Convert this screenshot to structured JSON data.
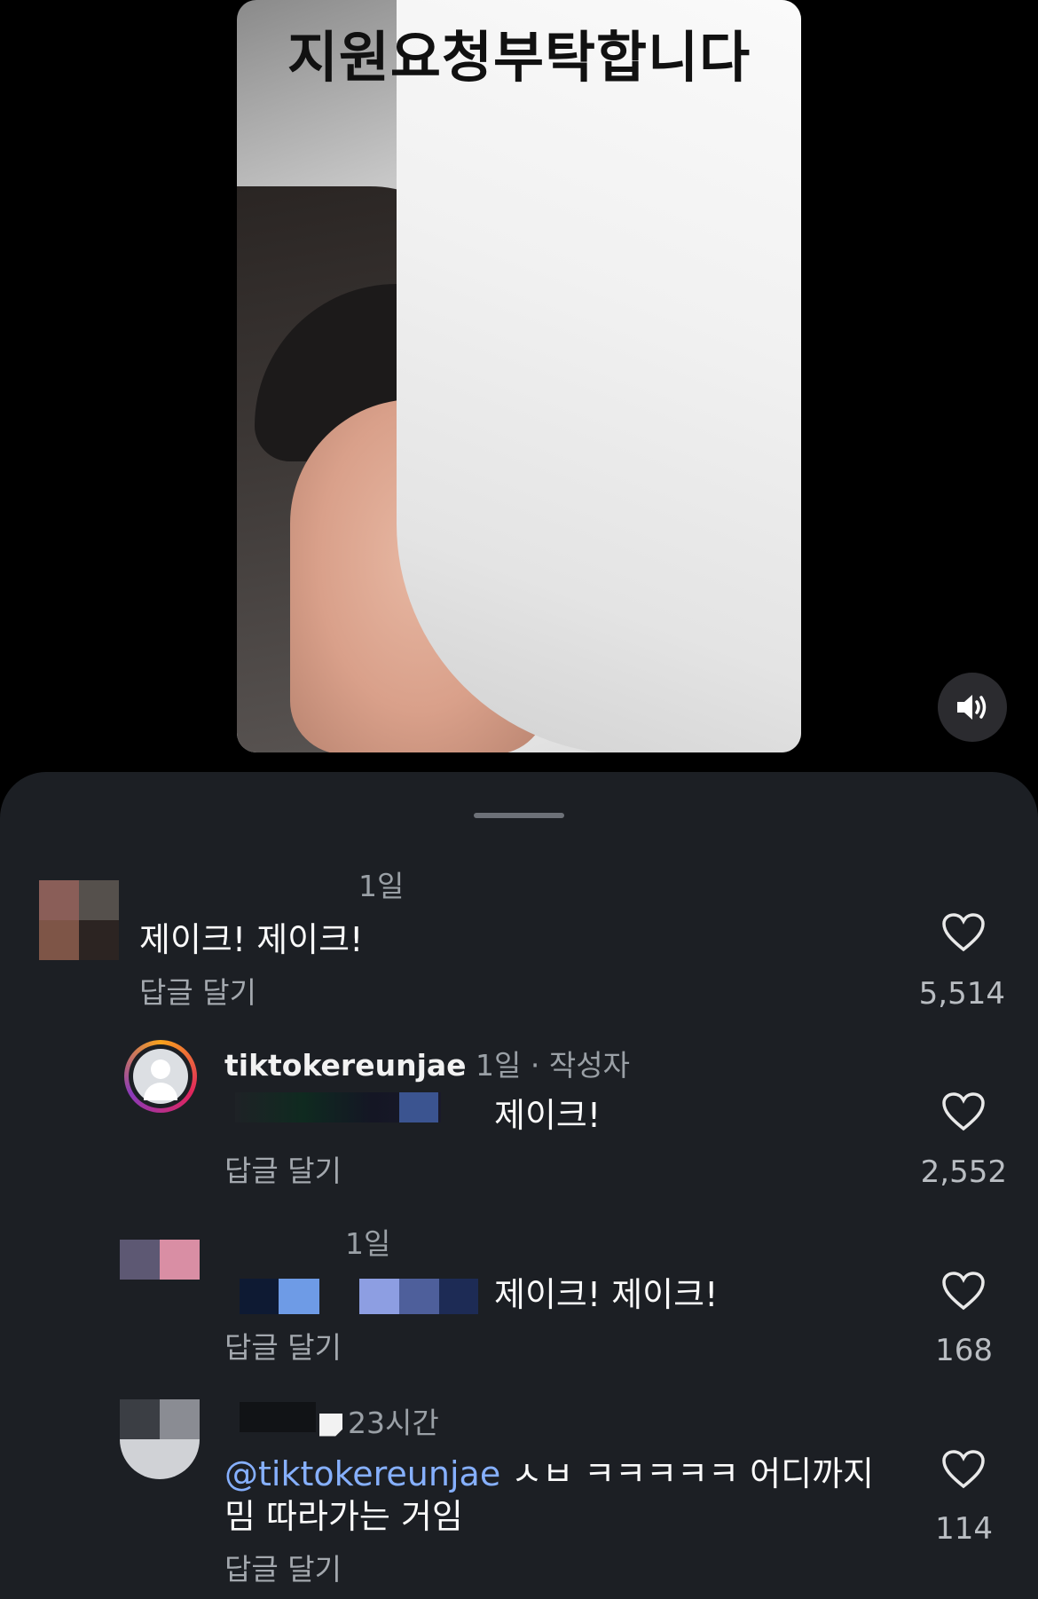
{
  "video": {
    "caption": "지원요청부탁합니다",
    "sound_icon": "speaker-icon"
  },
  "comments": [
    {
      "time": "1일",
      "text": "제이크! 제이크!",
      "reply_label": "답글 달기",
      "likes": "5,514"
    },
    {
      "username": "tiktokereunjae",
      "time": "1일",
      "author_tag": "· 작성자",
      "text": "제이크!",
      "reply_label": "답글 달기",
      "likes": "2,552"
    },
    {
      "time": "1일",
      "text": "제이크! 제이크!",
      "reply_label": "답글 달기",
      "likes": "168"
    },
    {
      "time": "23시간",
      "mention": "@tiktokereunjae",
      "text_line1": " ㅅㅂ ㅋㅋㅋㅋㅋ 어디까지",
      "text_line2": "밈 따라가는 거임",
      "reply_label": "답글 달기",
      "likes": "114"
    }
  ],
  "colors": {
    "sheet_bg": "#1c1f24",
    "mention": "#86b0ff",
    "muted_text": "#9aa0a6"
  }
}
